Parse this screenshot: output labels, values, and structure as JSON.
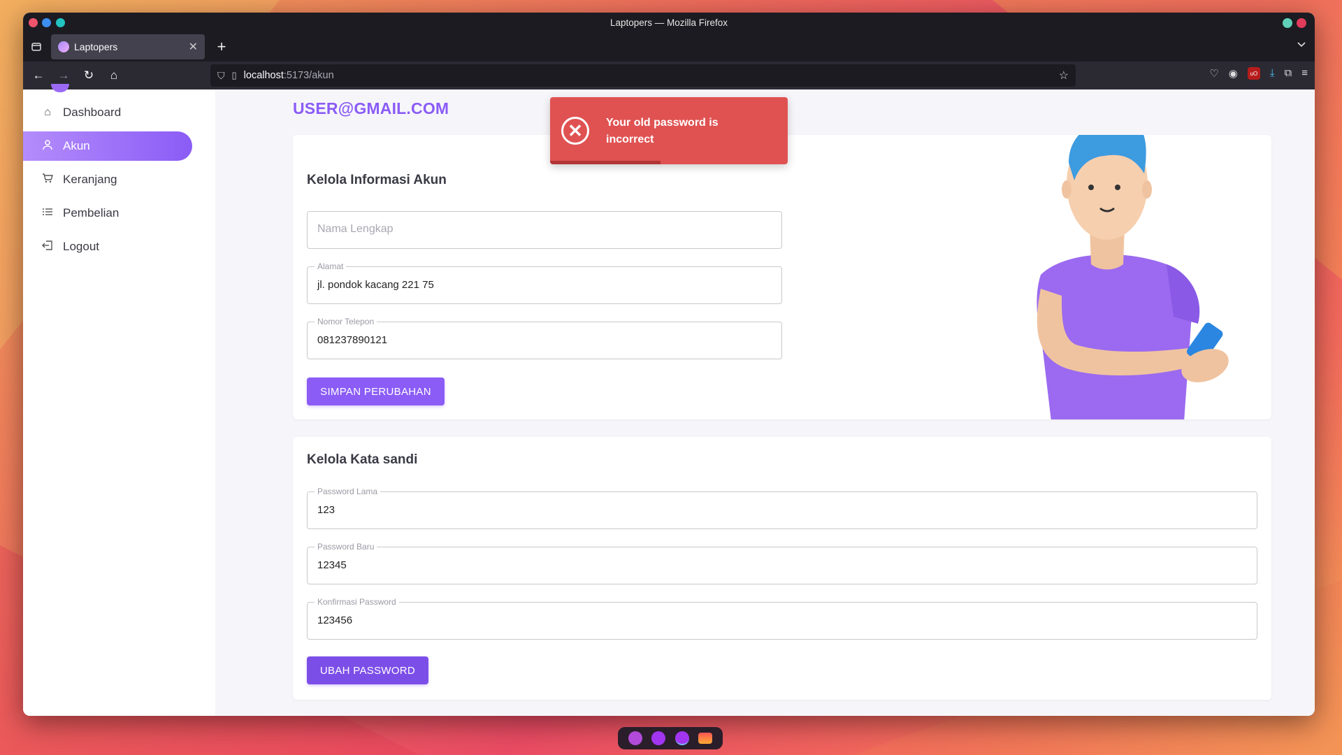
{
  "window": {
    "title": "Laptopers — Mozilla Firefox"
  },
  "tab": {
    "title": "Laptopers",
    "close": "✕"
  },
  "url": {
    "host": "localhost",
    "path": ":5173/akun"
  },
  "sidebar": {
    "items": [
      {
        "label": "Dashboard",
        "icon": "home-icon"
      },
      {
        "label": "Akun",
        "icon": "user-icon",
        "active": true
      },
      {
        "label": "Keranjang",
        "icon": "cart-icon"
      },
      {
        "label": "Pembelian",
        "icon": "list-icon"
      },
      {
        "label": "Logout",
        "icon": "logout-icon"
      }
    ]
  },
  "main": {
    "email": "USER@GMAIL.COM",
    "account": {
      "title": "Kelola Informasi Akun",
      "name_placeholder": "Nama Lengkap",
      "address_label": "Alamat",
      "address_value": "jl. pondok kacang 221 75",
      "phone_label": "Nomor Telepon",
      "phone_value": "081237890121",
      "save_button": "SIMPAN PERUBAHAN"
    },
    "password": {
      "title": "Kelola Kata sandi",
      "old_label": "Password Lama",
      "old_value": "123",
      "new_label": "Password Baru",
      "new_value": "12345",
      "confirm_label": "Konfirmasi Password",
      "confirm_value": "123456",
      "change_button": "UBAH PASSWORD"
    }
  },
  "toast": {
    "message": "Your old password is incorrect",
    "icon": "error-circle-icon"
  },
  "colors": {
    "accent": "#8b5cf6",
    "error": "#e05252"
  }
}
